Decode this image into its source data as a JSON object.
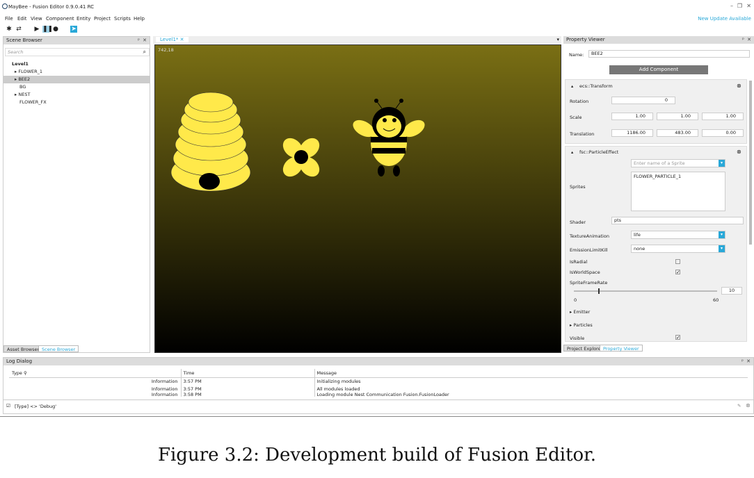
{
  "window": {
    "title": "MayBee - Fusion Editor 0.9.0.41 RC"
  },
  "menu": [
    "File",
    "Edit",
    "View",
    "Component",
    "Entity",
    "Project",
    "Scripts",
    "Help"
  ],
  "update": "New Update Available",
  "scene": {
    "title": "Scene Browser",
    "search_placeholder": "Search",
    "items": [
      "Level1",
      "FLOWER_1",
      "BEE2",
      "BG",
      "NEST",
      "FLOWER_FX"
    ],
    "tabs": [
      "Asset Browser",
      "Scene Browser"
    ]
  },
  "viewport": {
    "tab": "Level1*",
    "coords": "742,18"
  },
  "prop": {
    "title": "Property Viewer",
    "name_label": "Name:",
    "name_value": "BEE2",
    "add": "Add Component",
    "transform": {
      "title": "ecs::Transform",
      "rotation_label": "Rotation",
      "rotation": "0",
      "scale_label": "Scale",
      "scale": [
        "1.00",
        "1.00",
        "1.00"
      ],
      "translation_label": "Translation",
      "translation": [
        "1186.00",
        "483.00",
        "0.00"
      ]
    },
    "particle": {
      "title": "fsc::ParticleEffect",
      "sprite_placeholder": "Enter name of a Sprite",
      "sprites_label": "Sprites",
      "sprite_item": "FLOWER_PARTICLE_1",
      "shader_label": "Shader",
      "shader": "pts",
      "texanim_label": "TextureAnimation",
      "texanim": "life",
      "emit_label": "EmissionLimitKill",
      "emit": "none",
      "radial_label": "IsRadial",
      "world_label": "IsWorldSpace",
      "sfr_label": "SpriteFrameRate",
      "sfr_min": "0",
      "sfr_max": "60",
      "sfr_value": "10",
      "sfr_level": 0.17
    },
    "sections": [
      "Emitter",
      "Particles"
    ],
    "visible_label": "Visible",
    "tabs": [
      "Project Explorer",
      "Property Viewer"
    ]
  },
  "log": {
    "title": "Log Dialog",
    "cols": [
      "Type",
      "Time",
      "Message"
    ],
    "rows": [
      [
        "Information",
        "3:57 PM",
        "Initializing modules"
      ],
      [
        "Information",
        "3:57 PM",
        "All modules loaded"
      ],
      [
        "Information",
        "3:58 PM",
        "Loading module Nest Communication Fusion.FusionLoader"
      ]
    ],
    "filter": "[Type] <> 'Debug'"
  },
  "caption": "Figure 3.2: Development build of Fusion Editor."
}
